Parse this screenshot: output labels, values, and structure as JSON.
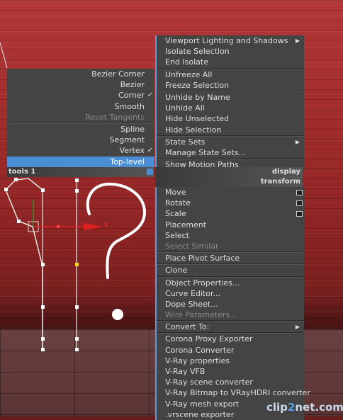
{
  "left_menu": {
    "items": [
      {
        "label": "Bezier Corner",
        "checked": false,
        "disabled": false
      },
      {
        "label": "Bezier",
        "checked": false,
        "disabled": false
      },
      {
        "label": "Corner",
        "checked": true,
        "disabled": false
      },
      {
        "label": "Smooth",
        "checked": false,
        "disabled": false
      },
      {
        "label": "Reset Tangents",
        "checked": false,
        "disabled": true
      },
      {
        "label": "Spline",
        "checked": false,
        "disabled": false
      },
      {
        "label": "Segment",
        "checked": false,
        "disabled": false
      },
      {
        "label": "Vertex",
        "checked": true,
        "disabled": false
      },
      {
        "label": "Top-level",
        "checked": false,
        "disabled": false,
        "highlighted": true
      }
    ],
    "header": "tools 1"
  },
  "right_menu": {
    "display_header": "display",
    "transform_header": "transform",
    "display_items": [
      {
        "label": "Viewport Lighting and Shadows",
        "submenu": true
      },
      {
        "label": "Isolate Selection"
      },
      {
        "label": "End Isolate"
      },
      {
        "label": "Unfreeze All"
      },
      {
        "label": "Freeze Selection"
      },
      {
        "label": "Unhide by Name"
      },
      {
        "label": "Unhide All"
      },
      {
        "label": "Hide Unselected"
      },
      {
        "label": "Hide Selection"
      },
      {
        "label": "State Sets",
        "submenu": true
      },
      {
        "label": "Manage State Sets..."
      },
      {
        "label": "Show Motion Paths"
      }
    ],
    "transform_items": [
      {
        "label": "Move",
        "settings": true
      },
      {
        "label": "Rotate",
        "settings": true
      },
      {
        "label": "Scale",
        "settings": true
      },
      {
        "label": "Placement"
      },
      {
        "label": "Select"
      },
      {
        "label": "Select Similar"
      },
      {
        "label": "Place Pivot Surface"
      },
      {
        "label": "Clone"
      },
      {
        "label": "Object Properties..."
      },
      {
        "label": "Curve Editor..."
      },
      {
        "label": "Dope Sheet..."
      },
      {
        "label": "Wire Parameters..."
      },
      {
        "label": "Convert To:",
        "submenu": true
      },
      {
        "label": "Corona Proxy Exporter"
      },
      {
        "label": "Corona Converter"
      },
      {
        "label": "V-Ray properties"
      },
      {
        "label": "V-Ray VFB"
      },
      {
        "label": "V-Ray scene converter"
      },
      {
        "label": "V-Ray Bitmap to VRayHDRI converter"
      },
      {
        "label": "V-Ray mesh export"
      },
      {
        "label": ".vrscene exporter"
      }
    ]
  },
  "viewport": {
    "axis_label": "x"
  },
  "watermark": {
    "text_a": "clip",
    "text_b": "2",
    "text_c": "net.com"
  },
  "colors": {
    "highlight": "#4a8fd6",
    "menu_bg": "#444444",
    "viewport_red": "#a02c2c"
  }
}
